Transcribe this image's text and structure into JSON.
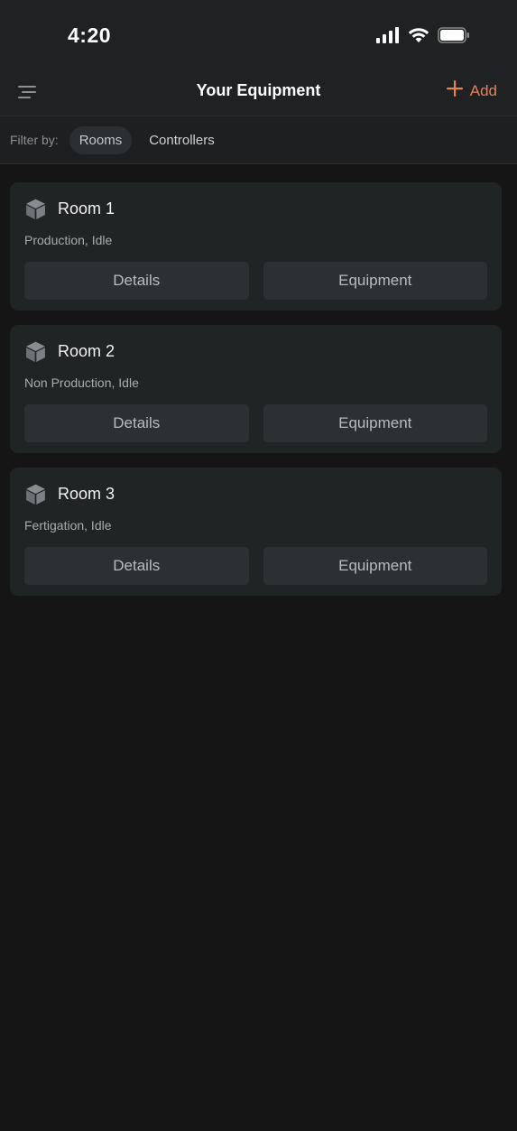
{
  "status_bar": {
    "time": "4:20",
    "signal_icon": "cellular-signal-icon",
    "wifi_icon": "wifi-icon",
    "battery_icon": "battery-icon"
  },
  "header": {
    "menu_icon": "menu-icon",
    "title": "Your Equipment",
    "add_label": "Add",
    "add_icon": "plus-icon",
    "accent_color": "#E8805A"
  },
  "filter": {
    "label": "Filter by:",
    "options": [
      "Rooms",
      "Controllers"
    ],
    "selected": "Rooms"
  },
  "rooms": [
    {
      "icon": "cube-icon",
      "name": "Room 1",
      "status": "Production, Idle",
      "details_label": "Details",
      "equipment_label": "Equipment"
    },
    {
      "icon": "cube-icon",
      "name": "Room 2",
      "status": "Non Production, Idle",
      "details_label": "Details",
      "equipment_label": "Equipment"
    },
    {
      "icon": "cube-icon",
      "name": "Room 3",
      "status": "Fertigation, Idle",
      "details_label": "Details",
      "equipment_label": "Equipment"
    }
  ]
}
